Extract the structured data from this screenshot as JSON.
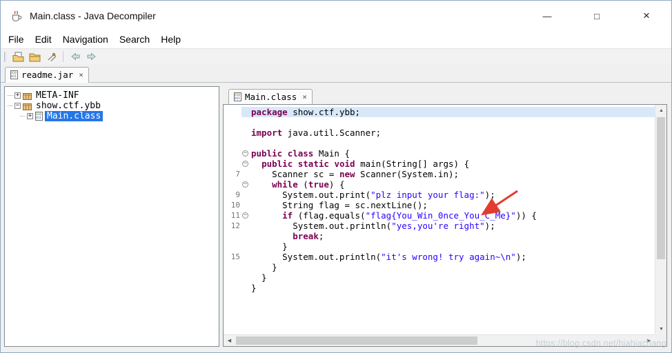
{
  "window": {
    "title": "Main.class - Java Decompiler",
    "controls": {
      "minimize": "—",
      "maximize": "□",
      "close": "×"
    }
  },
  "menu": [
    "File",
    "Edit",
    "Navigation",
    "Search",
    "Help"
  ],
  "toolbar": [
    "open-file",
    "open-folder",
    "attach",
    "separator",
    "back",
    "forward"
  ],
  "icons": {
    "up": "▲",
    "down": "▼",
    "left": "◀",
    "right": "▶",
    "tab_close": "×"
  },
  "jar_tab": {
    "label": "readme.jar",
    "icon": "binary-file-icon"
  },
  "editor_tab": {
    "label": "Main.class",
    "icon": "binary-file-icon"
  },
  "tree": [
    {
      "label": "META-INF",
      "level": 0,
      "expander": "+",
      "icon": "package-icon",
      "selected": false
    },
    {
      "label": "show.ctf.ybb",
      "level": 0,
      "expander": "−",
      "icon": "package-icon",
      "selected": false
    },
    {
      "label": "Main.class",
      "level": 1,
      "expander": "+",
      "icon": "class-icon",
      "selected": true
    }
  ],
  "code": {
    "lines": [
      {
        "num": "",
        "fold": false,
        "highlight": true,
        "tokens": [
          [
            "k",
            "package"
          ],
          [
            "p",
            " show.ctf.ybb;"
          ]
        ]
      },
      {
        "num": "",
        "fold": false,
        "tokens": []
      },
      {
        "num": "",
        "fold": false,
        "tokens": [
          [
            "k",
            "import"
          ],
          [
            "p",
            " java.util.Scanner;"
          ]
        ]
      },
      {
        "num": "",
        "fold": false,
        "tokens": []
      },
      {
        "num": "",
        "fold": true,
        "tokens": [
          [
            "k",
            "public"
          ],
          [
            "p",
            " "
          ],
          [
            "k",
            "class"
          ],
          [
            "p",
            " Main {"
          ]
        ]
      },
      {
        "num": "",
        "fold": true,
        "tokens": [
          [
            "p",
            "  "
          ],
          [
            "k",
            "public"
          ],
          [
            "p",
            " "
          ],
          [
            "k",
            "static"
          ],
          [
            "p",
            " "
          ],
          [
            "k",
            "void"
          ],
          [
            "p",
            " main(String[] args) {"
          ]
        ]
      },
      {
        "num": "7",
        "fold": false,
        "tokens": [
          [
            "p",
            "    Scanner sc = "
          ],
          [
            "k",
            "new"
          ],
          [
            "p",
            " Scanner(System.in);"
          ]
        ]
      },
      {
        "num": "",
        "fold": true,
        "tokens": [
          [
            "p",
            "    "
          ],
          [
            "k",
            "while"
          ],
          [
            "p",
            " ("
          ],
          [
            "k",
            "true"
          ],
          [
            "p",
            ") {"
          ]
        ]
      },
      {
        "num": "9",
        "fold": false,
        "tokens": [
          [
            "p",
            "      System.out.print("
          ],
          [
            "s",
            "\"plz input your flag:\""
          ],
          [
            "p",
            ");"
          ]
        ]
      },
      {
        "num": "10",
        "fold": false,
        "tokens": [
          [
            "p",
            "      String flag = sc.nextLine();"
          ]
        ]
      },
      {
        "num": "11",
        "fold": true,
        "tokens": [
          [
            "p",
            "      "
          ],
          [
            "k",
            "if"
          ],
          [
            "p",
            " (flag.equals("
          ],
          [
            "s",
            "\"flag{You_Win_0nce_You_C_Me}\""
          ],
          [
            "p",
            ")) {"
          ]
        ]
      },
      {
        "num": "12",
        "fold": false,
        "tokens": [
          [
            "p",
            "        System.out.println("
          ],
          [
            "s",
            "\"yes,you're right\""
          ],
          [
            "p",
            ");"
          ]
        ]
      },
      {
        "num": "",
        "fold": false,
        "tokens": [
          [
            "p",
            "        "
          ],
          [
            "k",
            "break"
          ],
          [
            "p",
            ";"
          ]
        ]
      },
      {
        "num": "",
        "fold": false,
        "tokens": [
          [
            "p",
            "      }"
          ]
        ]
      },
      {
        "num": "15",
        "fold": false,
        "tokens": [
          [
            "p",
            "      System.out.println("
          ],
          [
            "s",
            "\"it's wrong! try again~\\n\""
          ],
          [
            "p",
            ");"
          ]
        ]
      },
      {
        "num": "",
        "fold": false,
        "tokens": [
          [
            "p",
            "    }"
          ]
        ]
      },
      {
        "num": "",
        "fold": false,
        "tokens": [
          [
            "p",
            "  }"
          ]
        ]
      },
      {
        "num": "",
        "fold": false,
        "tokens": [
          [
            "p",
            "}"
          ]
        ]
      }
    ]
  },
  "colors": {
    "keyword": "#7B0052",
    "string": "#2A00FF",
    "selection": "#2677E8",
    "line_highlight": "#D8E8F8"
  },
  "watermark": "https://blog.csdn.net/hiahiachang"
}
